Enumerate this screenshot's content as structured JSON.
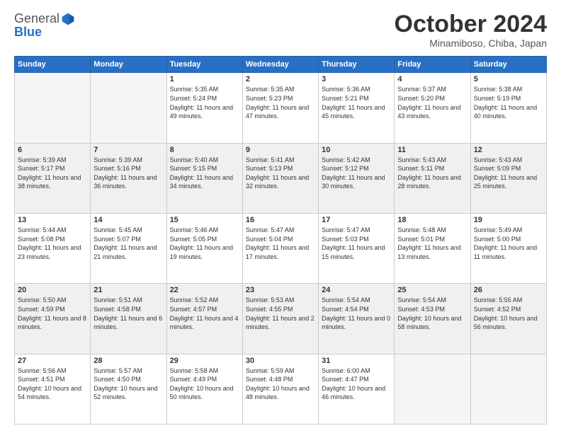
{
  "logo": {
    "general": "General",
    "blue": "Blue"
  },
  "header": {
    "month": "October 2024",
    "location": "Minamiboso, Chiba, Japan"
  },
  "weekdays": [
    "Sunday",
    "Monday",
    "Tuesday",
    "Wednesday",
    "Thursday",
    "Friday",
    "Saturday"
  ],
  "weeks": [
    [
      {
        "day": "",
        "text": ""
      },
      {
        "day": "",
        "text": ""
      },
      {
        "day": "1",
        "text": "Sunrise: 5:35 AM\nSunset: 5:24 PM\nDaylight: 11 hours and 49 minutes."
      },
      {
        "day": "2",
        "text": "Sunrise: 5:35 AM\nSunset: 5:23 PM\nDaylight: 11 hours and 47 minutes."
      },
      {
        "day": "3",
        "text": "Sunrise: 5:36 AM\nSunset: 5:21 PM\nDaylight: 11 hours and 45 minutes."
      },
      {
        "day": "4",
        "text": "Sunrise: 5:37 AM\nSunset: 5:20 PM\nDaylight: 11 hours and 43 minutes."
      },
      {
        "day": "5",
        "text": "Sunrise: 5:38 AM\nSunset: 5:19 PM\nDaylight: 11 hours and 40 minutes."
      }
    ],
    [
      {
        "day": "6",
        "text": "Sunrise: 5:39 AM\nSunset: 5:17 PM\nDaylight: 11 hours and 38 minutes."
      },
      {
        "day": "7",
        "text": "Sunrise: 5:39 AM\nSunset: 5:16 PM\nDaylight: 11 hours and 36 minutes."
      },
      {
        "day": "8",
        "text": "Sunrise: 5:40 AM\nSunset: 5:15 PM\nDaylight: 11 hours and 34 minutes."
      },
      {
        "day": "9",
        "text": "Sunrise: 5:41 AM\nSunset: 5:13 PM\nDaylight: 11 hours and 32 minutes."
      },
      {
        "day": "10",
        "text": "Sunrise: 5:42 AM\nSunset: 5:12 PM\nDaylight: 11 hours and 30 minutes."
      },
      {
        "day": "11",
        "text": "Sunrise: 5:43 AM\nSunset: 5:11 PM\nDaylight: 11 hours and 28 minutes."
      },
      {
        "day": "12",
        "text": "Sunrise: 5:43 AM\nSunset: 5:09 PM\nDaylight: 11 hours and 25 minutes."
      }
    ],
    [
      {
        "day": "13",
        "text": "Sunrise: 5:44 AM\nSunset: 5:08 PM\nDaylight: 11 hours and 23 minutes."
      },
      {
        "day": "14",
        "text": "Sunrise: 5:45 AM\nSunset: 5:07 PM\nDaylight: 11 hours and 21 minutes."
      },
      {
        "day": "15",
        "text": "Sunrise: 5:46 AM\nSunset: 5:05 PM\nDaylight: 11 hours and 19 minutes."
      },
      {
        "day": "16",
        "text": "Sunrise: 5:47 AM\nSunset: 5:04 PM\nDaylight: 11 hours and 17 minutes."
      },
      {
        "day": "17",
        "text": "Sunrise: 5:47 AM\nSunset: 5:03 PM\nDaylight: 11 hours and 15 minutes."
      },
      {
        "day": "18",
        "text": "Sunrise: 5:48 AM\nSunset: 5:01 PM\nDaylight: 11 hours and 13 minutes."
      },
      {
        "day": "19",
        "text": "Sunrise: 5:49 AM\nSunset: 5:00 PM\nDaylight: 11 hours and 11 minutes."
      }
    ],
    [
      {
        "day": "20",
        "text": "Sunrise: 5:50 AM\nSunset: 4:59 PM\nDaylight: 11 hours and 8 minutes."
      },
      {
        "day": "21",
        "text": "Sunrise: 5:51 AM\nSunset: 4:58 PM\nDaylight: 11 hours and 6 minutes."
      },
      {
        "day": "22",
        "text": "Sunrise: 5:52 AM\nSunset: 4:57 PM\nDaylight: 11 hours and 4 minutes."
      },
      {
        "day": "23",
        "text": "Sunrise: 5:53 AM\nSunset: 4:55 PM\nDaylight: 11 hours and 2 minutes."
      },
      {
        "day": "24",
        "text": "Sunrise: 5:54 AM\nSunset: 4:54 PM\nDaylight: 11 hours and 0 minutes."
      },
      {
        "day": "25",
        "text": "Sunrise: 5:54 AM\nSunset: 4:53 PM\nDaylight: 10 hours and 58 minutes."
      },
      {
        "day": "26",
        "text": "Sunrise: 5:55 AM\nSunset: 4:52 PM\nDaylight: 10 hours and 56 minutes."
      }
    ],
    [
      {
        "day": "27",
        "text": "Sunrise: 5:56 AM\nSunset: 4:51 PM\nDaylight: 10 hours and 54 minutes."
      },
      {
        "day": "28",
        "text": "Sunrise: 5:57 AM\nSunset: 4:50 PM\nDaylight: 10 hours and 52 minutes."
      },
      {
        "day": "29",
        "text": "Sunrise: 5:58 AM\nSunset: 4:49 PM\nDaylight: 10 hours and 50 minutes."
      },
      {
        "day": "30",
        "text": "Sunrise: 5:59 AM\nSunset: 4:48 PM\nDaylight: 10 hours and 48 minutes."
      },
      {
        "day": "31",
        "text": "Sunrise: 6:00 AM\nSunset: 4:47 PM\nDaylight: 10 hours and 46 minutes."
      },
      {
        "day": "",
        "text": ""
      },
      {
        "day": "",
        "text": ""
      }
    ]
  ]
}
